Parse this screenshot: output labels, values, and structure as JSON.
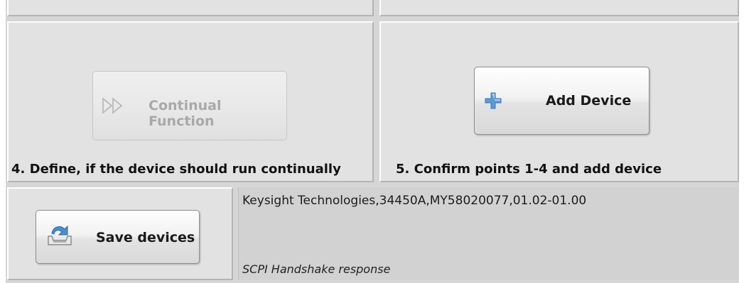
{
  "continual_function": {
    "label": "Continual Function",
    "enabled": false,
    "icon": "fast-forward-icon"
  },
  "add_device": {
    "label": "Add Device",
    "icon": "plus-icon"
  },
  "save_devices": {
    "label": "Save devices",
    "icon": "save-download-icon"
  },
  "steps": {
    "step4": "4. Define, if the device should run continually",
    "step5": "5. Confirm points 1-4 and add device"
  },
  "response": {
    "text": "Keysight Technologies,34450A,MY58020077,01.02-01.00",
    "caption": "SCPI Handshake response"
  },
  "colors": {
    "panel": "#e2e2e2",
    "response_bg": "#d2d2d2",
    "plus_icon": "#5b9bd5"
  }
}
